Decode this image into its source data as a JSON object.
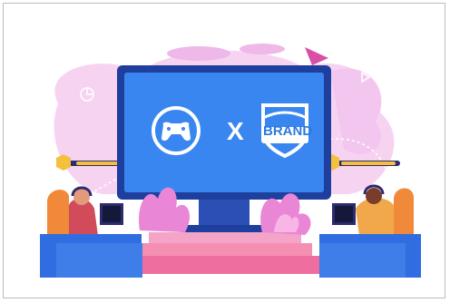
{
  "illustration": {
    "screen_x_label": "X",
    "shield_label": "BRAND"
  },
  "colors": {
    "monitor_frame": "#1f3f9e",
    "monitor_screen": "#3a86f0",
    "pink_blob": "#f3c6ef",
    "pink_plant": "#e986d6",
    "desk": "#3f7ee8",
    "stage": "#f58fb2",
    "orange_chair": "#f08a3a",
    "gold": "#f4c13c"
  },
  "icons": [
    "gamepad-icon",
    "brand-shield-icon",
    "paper-plane-icon",
    "gear-icon",
    "headset-icon"
  ]
}
